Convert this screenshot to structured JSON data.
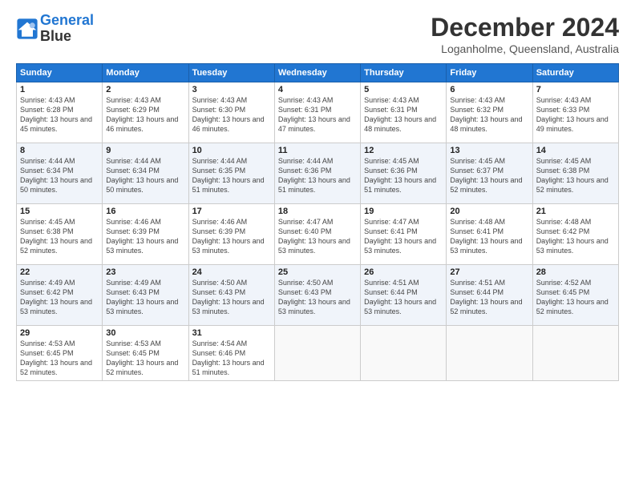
{
  "logo": {
    "line1": "General",
    "line2": "Blue"
  },
  "title": "December 2024",
  "location": "Loganholme, Queensland, Australia",
  "weekdays": [
    "Sunday",
    "Monday",
    "Tuesday",
    "Wednesday",
    "Thursday",
    "Friday",
    "Saturday"
  ],
  "weeks": [
    [
      {
        "day": 1,
        "sunrise": "4:43 AM",
        "sunset": "6:28 PM",
        "daylight": "13 hours and 45 minutes."
      },
      {
        "day": 2,
        "sunrise": "4:43 AM",
        "sunset": "6:29 PM",
        "daylight": "13 hours and 46 minutes."
      },
      {
        "day": 3,
        "sunrise": "4:43 AM",
        "sunset": "6:30 PM",
        "daylight": "13 hours and 46 minutes."
      },
      {
        "day": 4,
        "sunrise": "4:43 AM",
        "sunset": "6:31 PM",
        "daylight": "13 hours and 47 minutes."
      },
      {
        "day": 5,
        "sunrise": "4:43 AM",
        "sunset": "6:31 PM",
        "daylight": "13 hours and 48 minutes."
      },
      {
        "day": 6,
        "sunrise": "4:43 AM",
        "sunset": "6:32 PM",
        "daylight": "13 hours and 48 minutes."
      },
      {
        "day": 7,
        "sunrise": "4:43 AM",
        "sunset": "6:33 PM",
        "daylight": "13 hours and 49 minutes."
      }
    ],
    [
      {
        "day": 8,
        "sunrise": "4:44 AM",
        "sunset": "6:34 PM",
        "daylight": "13 hours and 50 minutes."
      },
      {
        "day": 9,
        "sunrise": "4:44 AM",
        "sunset": "6:34 PM",
        "daylight": "13 hours and 50 minutes."
      },
      {
        "day": 10,
        "sunrise": "4:44 AM",
        "sunset": "6:35 PM",
        "daylight": "13 hours and 51 minutes."
      },
      {
        "day": 11,
        "sunrise": "4:44 AM",
        "sunset": "6:36 PM",
        "daylight": "13 hours and 51 minutes."
      },
      {
        "day": 12,
        "sunrise": "4:45 AM",
        "sunset": "6:36 PM",
        "daylight": "13 hours and 51 minutes."
      },
      {
        "day": 13,
        "sunrise": "4:45 AM",
        "sunset": "6:37 PM",
        "daylight": "13 hours and 52 minutes."
      },
      {
        "day": 14,
        "sunrise": "4:45 AM",
        "sunset": "6:38 PM",
        "daylight": "13 hours and 52 minutes."
      }
    ],
    [
      {
        "day": 15,
        "sunrise": "4:45 AM",
        "sunset": "6:38 PM",
        "daylight": "13 hours and 52 minutes."
      },
      {
        "day": 16,
        "sunrise": "4:46 AM",
        "sunset": "6:39 PM",
        "daylight": "13 hours and 53 minutes."
      },
      {
        "day": 17,
        "sunrise": "4:46 AM",
        "sunset": "6:39 PM",
        "daylight": "13 hours and 53 minutes."
      },
      {
        "day": 18,
        "sunrise": "4:47 AM",
        "sunset": "6:40 PM",
        "daylight": "13 hours and 53 minutes."
      },
      {
        "day": 19,
        "sunrise": "4:47 AM",
        "sunset": "6:41 PM",
        "daylight": "13 hours and 53 minutes."
      },
      {
        "day": 20,
        "sunrise": "4:48 AM",
        "sunset": "6:41 PM",
        "daylight": "13 hours and 53 minutes."
      },
      {
        "day": 21,
        "sunrise": "4:48 AM",
        "sunset": "6:42 PM",
        "daylight": "13 hours and 53 minutes."
      }
    ],
    [
      {
        "day": 22,
        "sunrise": "4:49 AM",
        "sunset": "6:42 PM",
        "daylight": "13 hours and 53 minutes."
      },
      {
        "day": 23,
        "sunrise": "4:49 AM",
        "sunset": "6:43 PM",
        "daylight": "13 hours and 53 minutes."
      },
      {
        "day": 24,
        "sunrise": "4:50 AM",
        "sunset": "6:43 PM",
        "daylight": "13 hours and 53 minutes."
      },
      {
        "day": 25,
        "sunrise": "4:50 AM",
        "sunset": "6:43 PM",
        "daylight": "13 hours and 53 minutes."
      },
      {
        "day": 26,
        "sunrise": "4:51 AM",
        "sunset": "6:44 PM",
        "daylight": "13 hours and 53 minutes."
      },
      {
        "day": 27,
        "sunrise": "4:51 AM",
        "sunset": "6:44 PM",
        "daylight": "13 hours and 52 minutes."
      },
      {
        "day": 28,
        "sunrise": "4:52 AM",
        "sunset": "6:45 PM",
        "daylight": "13 hours and 52 minutes."
      }
    ],
    [
      {
        "day": 29,
        "sunrise": "4:53 AM",
        "sunset": "6:45 PM",
        "daylight": "13 hours and 52 minutes."
      },
      {
        "day": 30,
        "sunrise": "4:53 AM",
        "sunset": "6:45 PM",
        "daylight": "13 hours and 52 minutes."
      },
      {
        "day": 31,
        "sunrise": "4:54 AM",
        "sunset": "6:46 PM",
        "daylight": "13 hours and 51 minutes."
      },
      null,
      null,
      null,
      null
    ]
  ]
}
